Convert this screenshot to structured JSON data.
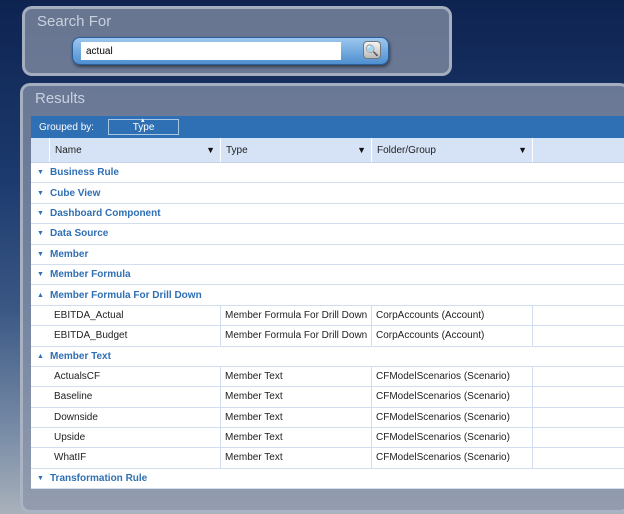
{
  "search": {
    "title": "Search For",
    "value": "actual"
  },
  "results": {
    "title": "Results",
    "grouped_by_label": "Grouped by:",
    "grouped_by_value": "Type",
    "columns": [
      "Name",
      "Type",
      "Folder/Group"
    ],
    "groups": [
      {
        "label": "Business Rule",
        "expanded": false,
        "rows": []
      },
      {
        "label": "Cube View",
        "expanded": false,
        "rows": []
      },
      {
        "label": "Dashboard Component",
        "expanded": false,
        "rows": []
      },
      {
        "label": "Data Source",
        "expanded": false,
        "rows": []
      },
      {
        "label": "Member",
        "expanded": false,
        "rows": []
      },
      {
        "label": "Member Formula",
        "expanded": false,
        "rows": []
      },
      {
        "label": "Member Formula For Drill Down",
        "expanded": true,
        "rows": [
          [
            "EBITDA_Actual",
            "Member Formula For Drill Down",
            "CorpAccounts (Account)"
          ],
          [
            "EBITDA_Budget",
            "Member Formula For Drill Down",
            "CorpAccounts (Account)"
          ]
        ]
      },
      {
        "label": "Member Text",
        "expanded": true,
        "rows": [
          [
            "ActualsCF",
            "Member Text",
            "CFModelScenarios (Scenario)"
          ],
          [
            "Baseline",
            "Member Text",
            "CFModelScenarios (Scenario)"
          ],
          [
            "Downside",
            "Member Text",
            "CFModelScenarios (Scenario)"
          ],
          [
            "Upside",
            "Member Text",
            "CFModelScenarios (Scenario)"
          ],
          [
            "WhatIF",
            "Member Text",
            "CFModelScenarios (Scenario)"
          ]
        ]
      },
      {
        "label": "Transformation Rule",
        "expanded": false,
        "rows": []
      }
    ]
  }
}
